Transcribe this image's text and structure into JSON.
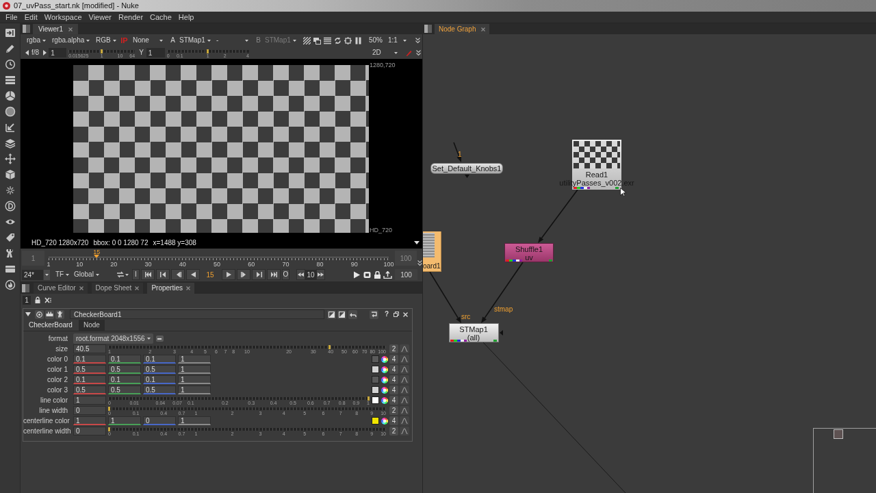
{
  "window": {
    "title": "07_uvPass_start.nk [modified] - Nuke"
  },
  "menu_bar": [
    "File",
    "Edit",
    "Workspace",
    "Viewer",
    "Render",
    "Cache",
    "Help"
  ],
  "viewer": {
    "tab": {
      "label": "Viewer1",
      "selected": true
    },
    "channel_menus": [
      "rgba",
      "rgba.alpha",
      "RGB"
    ],
    "input_process": "IP",
    "display_menu": "None",
    "input_a": {
      "label": "A",
      "value": "STMap1",
      "disabled": false
    },
    "wipe_menu": "-",
    "input_b": {
      "label": "B",
      "value": "STMap1",
      "disabled": true
    },
    "zoom": "50%",
    "proxy_menu": "1:1",
    "fstop": "f/8",
    "gain_value": "1",
    "gain_slider": {
      "level": 0.5,
      "ticks": [
        "0.015625",
        "1",
        "10",
        "64"
      ]
    },
    "gamma_label": "Y",
    "gamma_value": "1",
    "gamma_slider": {
      "level": 0.5,
      "ticks": [
        "0",
        "0.1",
        "1",
        "2",
        "4"
      ]
    },
    "view_menu": "2D",
    "format_labels": [
      "1280,720",
      "HD_720"
    ],
    "info": [
      "HD_720 1280x720",
      "bbox: 0 0 1280 72",
      "x=1488 y=308"
    ]
  },
  "timeline": {
    "first_frame": "1",
    "last_frame": "100",
    "playhead": {
      "label": "15",
      "level": 0.1414
    },
    "ticks": [
      "1",
      "10",
      "20",
      "30",
      "40",
      "50",
      "60",
      "70",
      "80",
      "90",
      "100"
    ],
    "fps": "24*",
    "time_display": "TF",
    "range": "Global",
    "in_button": "I",
    "current_frame": "15",
    "out_button": "O",
    "increment": "10",
    "end_frame": "100"
  },
  "panel_tabs": [
    {
      "label": "Curve Editor",
      "selected": false
    },
    {
      "label": "Dope Sheet",
      "selected": false
    },
    {
      "label": "Properties",
      "selected": true
    }
  ],
  "properties": {
    "max_panels": "1",
    "panel": {
      "name": "CheckerBoard1",
      "help": "?",
      "tabs": [
        {
          "label": "CheckerBoard",
          "selected": true
        },
        {
          "label": "Node",
          "selected": false
        }
      ],
      "knobs": [
        {
          "kind": "dropdown",
          "label": "format",
          "value": "root.format 2048x1556"
        },
        {
          "kind": "logslider",
          "label": "size",
          "value": "40.5",
          "level": 0.8,
          "ticks": [
            "1",
            "2",
            "3",
            "4",
            "5",
            "6",
            "7",
            "8",
            "10",
            "20",
            "30",
            "40",
            "50",
            "60",
            "70",
            "80",
            "100"
          ],
          "channels": "2"
        },
        {
          "kind": "color",
          "label": "color 0",
          "values": [
            "0.1",
            "0.1",
            "0.1",
            "1"
          ],
          "color": "#5a5a5a",
          "channels": "4"
        },
        {
          "kind": "color",
          "label": "color 1",
          "values": [
            "0.5",
            "0.5",
            "0.5",
            "1"
          ],
          "color": "#d2d2d2",
          "channels": "4"
        },
        {
          "kind": "color",
          "label": "color 2",
          "values": [
            "0.1",
            "0.1",
            "0.1",
            "1"
          ],
          "color": "#5a5a5a",
          "channels": "4"
        },
        {
          "kind": "color",
          "label": "color 3",
          "values": [
            "0.5",
            "0.5",
            "0.5",
            "1"
          ],
          "color": "#d2d2d2",
          "channels": "4"
        },
        {
          "kind": "colorslider",
          "label": "line color",
          "value": "1",
          "level": 1,
          "ticks": [
            "0",
            "0.01",
            "0.04",
            "0.07",
            "0.1",
            "0.2",
            "0.3",
            "0.4",
            "0.5",
            "0.6",
            "0.7",
            "0.8",
            "0.9",
            "1"
          ],
          "color": "#ffffff",
          "channels": "4"
        },
        {
          "kind": "sqrtslider",
          "label": "line width",
          "value": "0",
          "level": 0,
          "ticks": [
            "0",
            "0.1",
            "0.4",
            "0.7",
            "1",
            "2",
            "3",
            "4",
            "5",
            "6",
            "7",
            "8",
            "9",
            "10"
          ],
          "channels": "2"
        },
        {
          "kind": "color",
          "label": "centerline color",
          "values": [
            "1",
            "1",
            "0",
            "1"
          ],
          "color": "#f0e400",
          "channels": "4"
        },
        {
          "kind": "sqrtslider",
          "label": "centerline width",
          "value": "0",
          "level": 0,
          "ticks": [
            "0",
            "0.1",
            "0.4",
            "0.7",
            "1",
            "2",
            "3",
            "4",
            "5",
            "6",
            "7",
            "8",
            "9",
            "10"
          ],
          "channels": "2"
        }
      ]
    }
  },
  "node_graph": {
    "tab": {
      "label": "Node Graph",
      "selected": true
    },
    "nodes": [
      {
        "kind": "noop",
        "label": "Set_Default_Knobs1",
        "input_label": "1"
      },
      {
        "kind": "read",
        "label": "Read1",
        "sublabel": "utilityPasses_v002.exr"
      },
      {
        "kind": "checkerboard",
        "label": "oard1"
      },
      {
        "kind": "shuffle",
        "label": "Shuffle1",
        "sublabel": "uv"
      },
      {
        "kind": "stmap",
        "label": "STMap1",
        "sublabel": "(all)",
        "input_labels": [
          "src",
          "stmap"
        ]
      }
    ]
  }
}
